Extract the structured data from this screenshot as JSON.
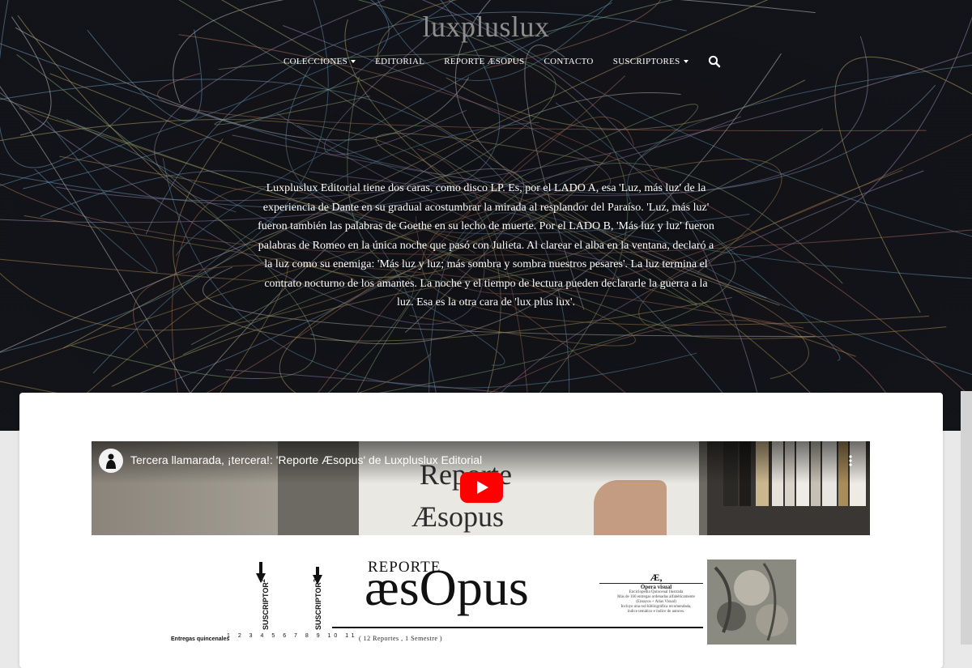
{
  "site": {
    "brand": "luxpluslux"
  },
  "nav": {
    "items": [
      {
        "label": "COLECCIONES",
        "dropdown": true
      },
      {
        "label": "EDITORIAL",
        "dropdown": false
      },
      {
        "label": "REPORTE ÆSOPUS",
        "dropdown": false
      },
      {
        "label": "CONTACTO",
        "dropdown": false
      },
      {
        "label": "SUSCRIPTORES",
        "dropdown": true
      }
    ],
    "search_icon": "search-icon"
  },
  "hero": {
    "intro": "Luxpluslux Editorial tiene dos caras, como disco LP. Es, por el LADO A, esa 'Luz, más luz' de la experiencia de Dante en su gradual acostumbrar la mirada al resplandor del Paraíso. 'Luz, más luz' fueron también las palabras de Goethe en su lecho de muerte. Por el LADO B, 'Más luz y luz' fueron palabras de Romeo en la única noche que pasó con Julieta. Al clarear el alba en la ventana, declaró a la luz como su enemiga: 'Más luz y luz; más sombra y sombra nuestros pesares'. La luz termina el contrato nocturno de los amantes. La noche y el tiempo de lectura pueden declararle la guerra a la luz. Esa es la otra cara de 'lux plus lux'."
  },
  "video": {
    "title": "Tercera llamarada, ¡tercera!: 'Reporte Æsopus' de Luxpluslux Editorial",
    "frame_text_1": "Reporte",
    "frame_text_2": "Æsopus",
    "colors": {
      "play": "#ff0000"
    }
  },
  "document": {
    "reporte": "REPORTE",
    "title": "æsOpus",
    "suscriptor": "SUSCRIPTOR",
    "suscriptor_sup": "2",
    "entregas": "Entregas quincenales",
    "ticks": "1 2 3 4 5 6 7 8 9 10 11",
    "footnote": "( 12 Reportes , 1 Semestre )",
    "ae_heading": "Æ,",
    "ae_sub": "Ópera visual",
    "ae_line1": "Enciclopedia Quincenal Ilustrada",
    "ae_line2": "Más de 160 entregas ordenadas alfabéticamente",
    "ae_line3": "(Ensayos + Atlas Visual)",
    "ae_line4": "Incluye una red bibliográfica recomendada,",
    "ae_line5": "índice temático e índice de autores."
  }
}
